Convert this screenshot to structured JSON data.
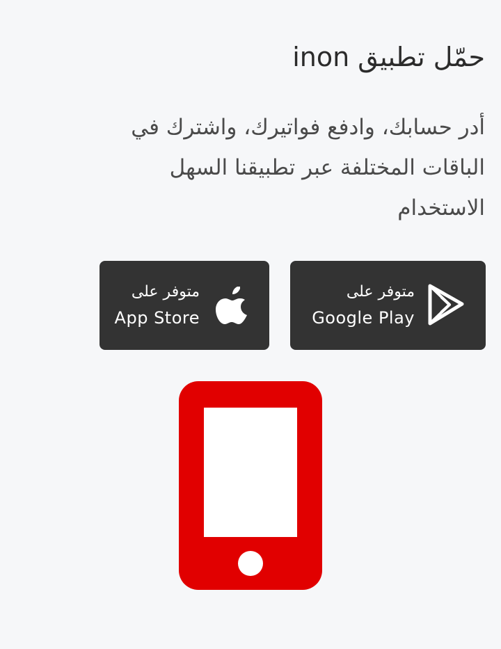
{
  "section": {
    "title": "حمّل تطبيق inon",
    "description": "أدر حسابك، وادفع فواتيرك، واشترك في الباقات المختلفة عبر تطبيقنا السهل الاستخدام"
  },
  "google_play": {
    "small_label": "متوفر على",
    "store_name": "Google Play",
    "icon": "google-play-icon"
  },
  "app_store": {
    "small_label": "متوفر على",
    "store_name": "App Store",
    "icon": "apple-icon"
  },
  "illustration": {
    "icon": "mobile-phone-icon",
    "color": "#e10000"
  },
  "theme": {
    "background": "#f6f7f9",
    "button_background": "#333333",
    "text_color": "#2d2d2d",
    "accent_red": "#e10000"
  }
}
